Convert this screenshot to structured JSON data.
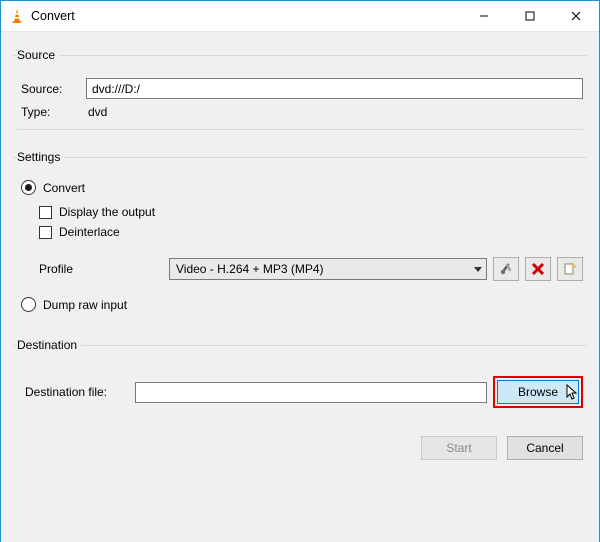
{
  "window": {
    "title": "Convert"
  },
  "source": {
    "legend": "Source",
    "source_label": "Source:",
    "source_value": "dvd:///D:/",
    "type_label": "Type:",
    "type_value": "dvd"
  },
  "settings": {
    "legend": "Settings",
    "convert_label": "Convert",
    "display_output_label": "Display the output",
    "deinterlace_label": "Deinterlace",
    "profile_label": "Profile",
    "profile_value": "Video - H.264 + MP3 (MP4)",
    "dump_label": "Dump raw input"
  },
  "destination": {
    "legend": "Destination",
    "file_label": "Destination file:",
    "file_value": "",
    "browse_label": "Browse"
  },
  "footer": {
    "start_label": "Start",
    "cancel_label": "Cancel"
  }
}
